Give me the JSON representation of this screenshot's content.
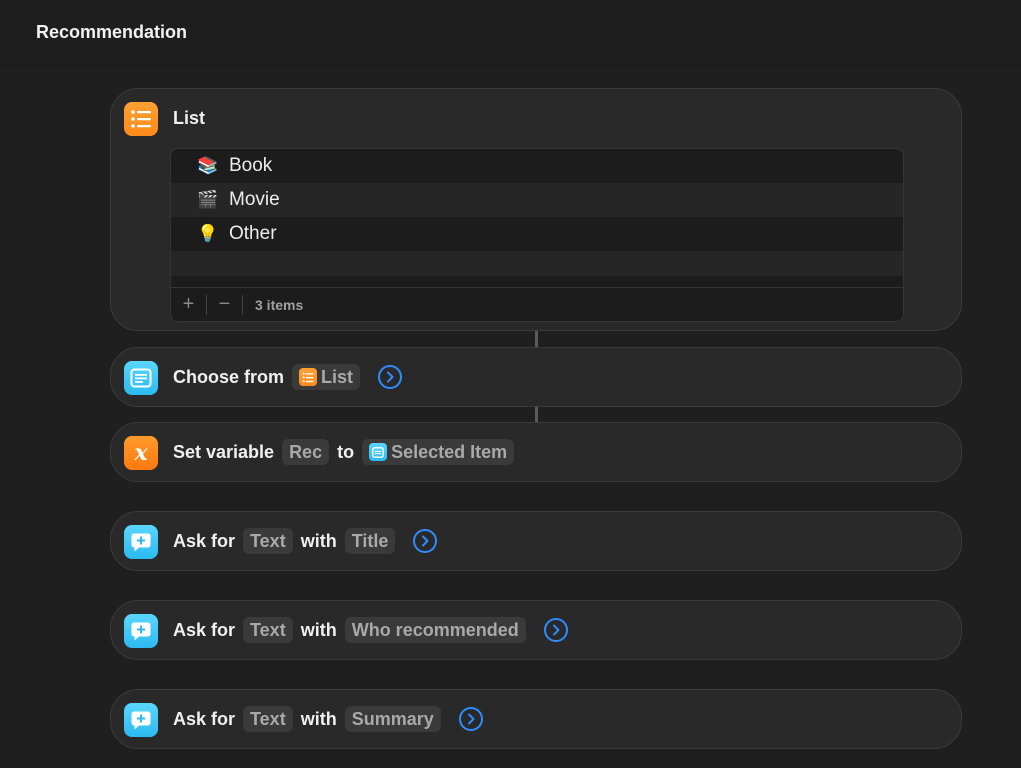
{
  "window": {
    "title": "Recommendation"
  },
  "list_action": {
    "title": "List",
    "items": [
      {
        "emoji": "📚",
        "label": "Book"
      },
      {
        "emoji": "🎬",
        "label": "Movie"
      },
      {
        "emoji": "💡",
        "label": "Other"
      }
    ],
    "add_label": "+",
    "remove_label": "−",
    "count_label": "3 items"
  },
  "choose_action": {
    "label": "Choose from",
    "token": "List"
  },
  "set_variable_action": {
    "label": "Set variable",
    "variable": "Rec",
    "to_label": "to",
    "token": "Selected Item"
  },
  "ask_actions": [
    {
      "label": "Ask for",
      "type": "Text",
      "with_label": "with",
      "prompt": "Title"
    },
    {
      "label": "Ask for",
      "type": "Text",
      "with_label": "with",
      "prompt": "Who recommended"
    },
    {
      "label": "Ask for",
      "type": "Text",
      "with_label": "with",
      "prompt": "Summary"
    }
  ],
  "colors": {
    "accent": "#2e8cff",
    "list_icon": "#ff8a1a",
    "ask_icon": "#2cbaf0"
  }
}
